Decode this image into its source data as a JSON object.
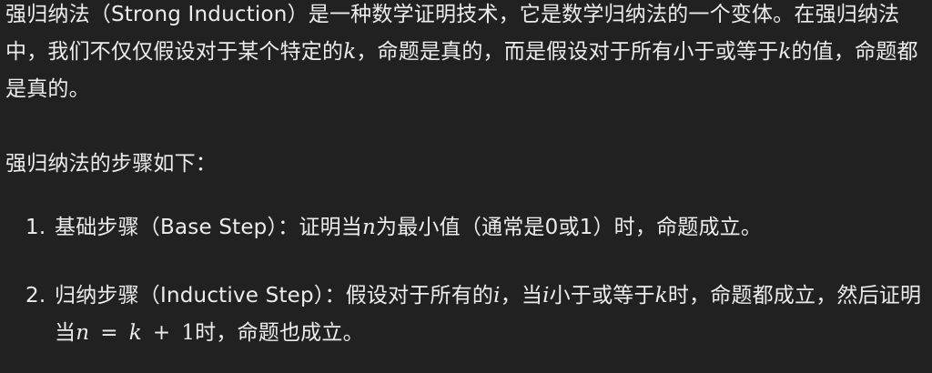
{
  "intro": {
    "t1": "强归纳法（Strong Induction）是一种数学证明技术，它是数学归纳法的一个变体。在强归纳法中，我们不仅仅假设对于某个特定的",
    "v_k": "k",
    "t2": "，命题是真的，而是假设对于所有小于或等于",
    "v_k2": "k",
    "t3": "的值，命题都是真的。"
  },
  "steps_intro": "强归纳法的步骤如下：",
  "steps": [
    {
      "num": "1.",
      "t1": "基础步骤（Base Step）：证明当",
      "v_n": "n",
      "t2": "为最小值（通常是0或1）时，命题成立。"
    },
    {
      "num": "2.",
      "t1": "归纳步骤（Inductive Step）：假设对于所有的",
      "v_i": "i",
      "t2": "，当",
      "v_i2": "i",
      "t3": "小于或等于",
      "v_k": "k",
      "t4": "时，命题都成立，然后证明当",
      "v_n": "n",
      "op_eq": "=",
      "v_k2": "k",
      "op_plus": "+",
      "v_one": "1",
      "t5": "时，命题也成立。"
    }
  ]
}
